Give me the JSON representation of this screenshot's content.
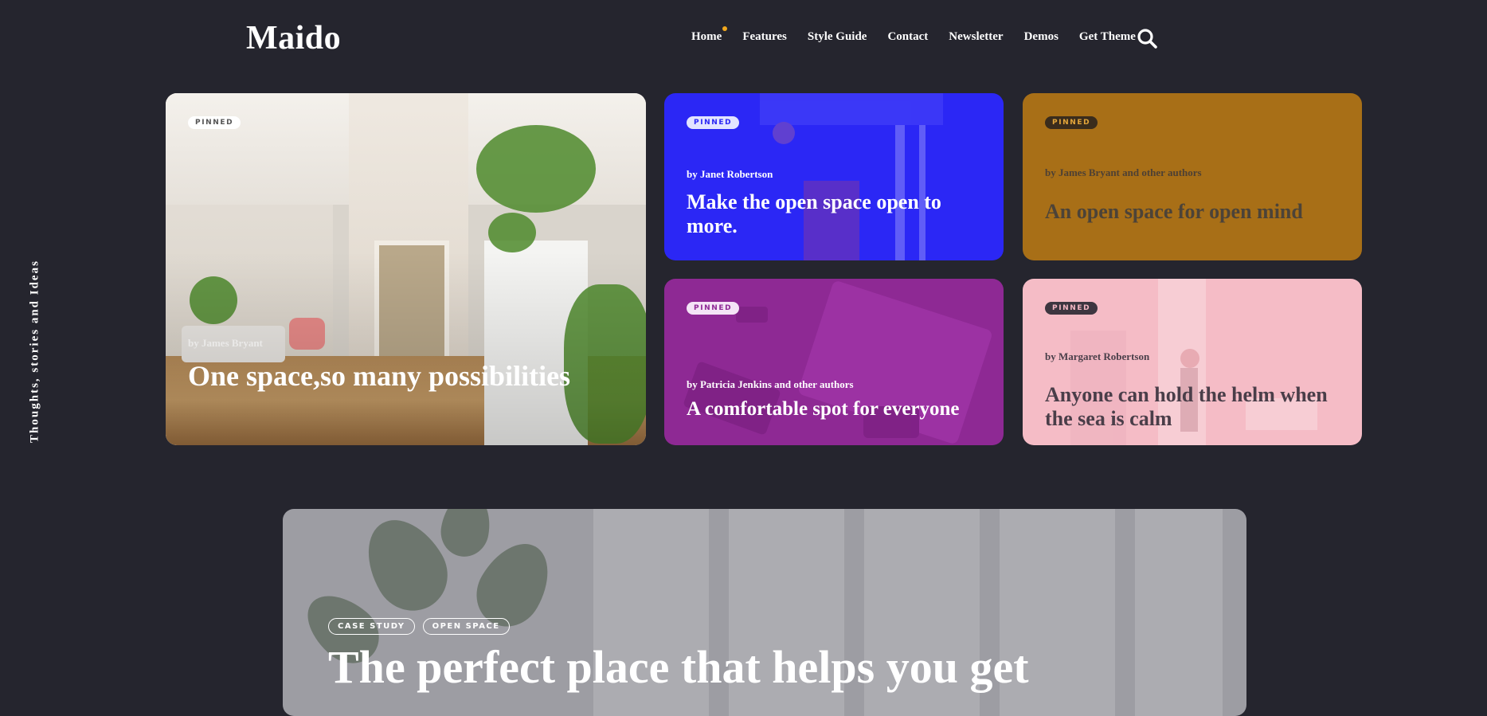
{
  "header": {
    "logo": "Maido",
    "nav": [
      "Home",
      "Features",
      "Style Guide",
      "Contact",
      "Newsletter",
      "Demos",
      "Get Theme"
    ],
    "active_item": "Home",
    "accent_color": "#f2a81d"
  },
  "side_text": "Thoughts, stories and Ideas",
  "cards": [
    {
      "badge": "PINNED",
      "author": "by James Bryant",
      "title": "One space,so many possibilities",
      "color": "photo"
    },
    {
      "badge": "PINNED",
      "author": "by Janet Robertson",
      "title": "Make the open space open to more.",
      "color": "#2b27f5"
    },
    {
      "badge": "PINNED",
      "author": "by James Bryant and other authors",
      "title": "An open space for open mind",
      "color": "#a86f17"
    },
    {
      "badge": "PINNED",
      "author": "by Patricia Jenkins and other authors",
      "title": "A comfortable spot for everyone",
      "color": "#8e2994"
    },
    {
      "badge": "PINNED",
      "author": "by Margaret Robertson",
      "title": "Anyone can hold the helm when the sea is calm",
      "color": "#f5bcc6"
    }
  ],
  "hero": {
    "tags": [
      "CASE STUDY",
      "OPEN SPACE"
    ],
    "title": "The perfect place that helps you get"
  }
}
